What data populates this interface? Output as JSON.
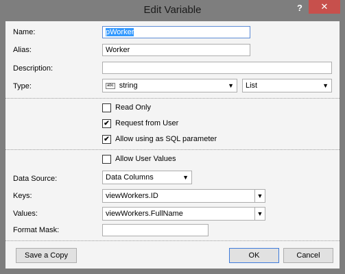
{
  "window": {
    "title": "Edit Variable",
    "help": "?",
    "close": "✕"
  },
  "fields": {
    "name": {
      "label": "Name:",
      "value": "pWorker"
    },
    "alias": {
      "label": "Alias:",
      "value": "Worker"
    },
    "description": {
      "label": "Description:",
      "value": ""
    },
    "type": {
      "label": "Type:",
      "value": "string",
      "icon": "abc",
      "mode": "List"
    }
  },
  "options": {
    "read_only": {
      "label": "Read Only",
      "checked": false
    },
    "request_from_user": {
      "label": "Request from User",
      "checked": true
    },
    "allow_sql": {
      "label": "Allow using as SQL parameter",
      "checked": true
    },
    "allow_user_values": {
      "label": "Allow User Values",
      "checked": false
    }
  },
  "datasource": {
    "source": {
      "label": "Data Source:",
      "value": "Data Columns"
    },
    "keys": {
      "label": "Keys:",
      "value": "viewWorkers.ID"
    },
    "values": {
      "label": "Values:",
      "value": "viewWorkers.FullName"
    },
    "format_mask": {
      "label": "Format Mask:",
      "value": ""
    }
  },
  "buttons": {
    "save_copy": "Save a Copy",
    "ok": "OK",
    "cancel": "Cancel"
  },
  "check_mark": "✔",
  "arrow": "▼"
}
